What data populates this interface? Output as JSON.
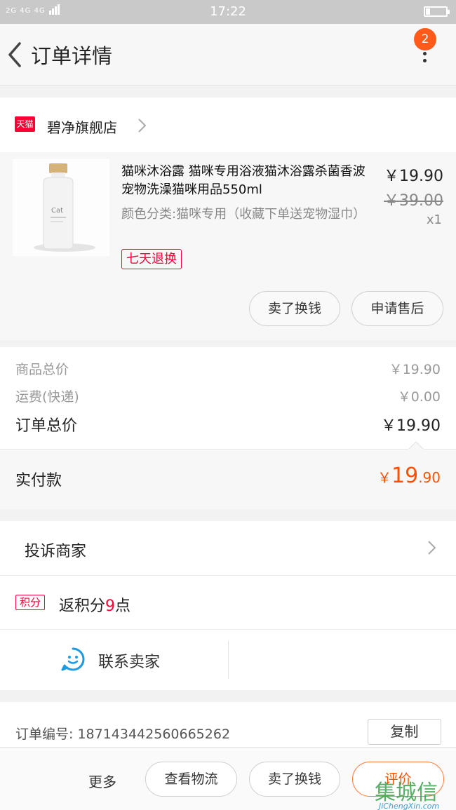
{
  "statusbar": {
    "network": "2G 4G 4G",
    "time": "17:22"
  },
  "header": {
    "title": "订单详情",
    "badge_count": "2"
  },
  "shop": {
    "badge": "天猫",
    "name": "碧净旗舰店"
  },
  "product": {
    "name": "猫咪沐浴露 猫咪专用浴液猫沐浴露杀菌香波宠物洗澡猫咪用品550ml",
    "spec": "颜色分类:猫咪专用（收藏下单送宠物湿巾）",
    "bottle_label": "Cat",
    "tag": "七天退换",
    "price": "￥19.90",
    "original_price": "￥39.00",
    "quantity": "x1",
    "actions": [
      "卖了换钱",
      "申请售后"
    ]
  },
  "summary": {
    "rows": [
      {
        "label": "商品总价",
        "value": "￥19.90"
      },
      {
        "label": "运费(快递)",
        "value": "￥0.00"
      },
      {
        "label": "订单总价",
        "value": "￥19.90"
      }
    ],
    "paid_label": "实付款",
    "paid_currency": "￥",
    "paid_int": "19",
    "paid_dec": ".90"
  },
  "complain": {
    "label": "投诉商家"
  },
  "points": {
    "tag": "积分",
    "prefix": "返积分",
    "number": "9",
    "suffix": "点"
  },
  "contact": {
    "label": "联系卖家"
  },
  "order": {
    "label": "订单编号:  187143442560665262",
    "copy_label": "复制"
  },
  "bottombar": {
    "more": "更多",
    "buttons": [
      "查看物流",
      "卖了换钱",
      "评价"
    ]
  },
  "watermark": {
    "text": "集城信",
    "url": "JiChengXin.com"
  },
  "colors": {
    "accent": "#ff5000",
    "tmall_red": "#ff0036",
    "badge": "#ff5a1a",
    "contact_icon": "#1e9be0"
  }
}
